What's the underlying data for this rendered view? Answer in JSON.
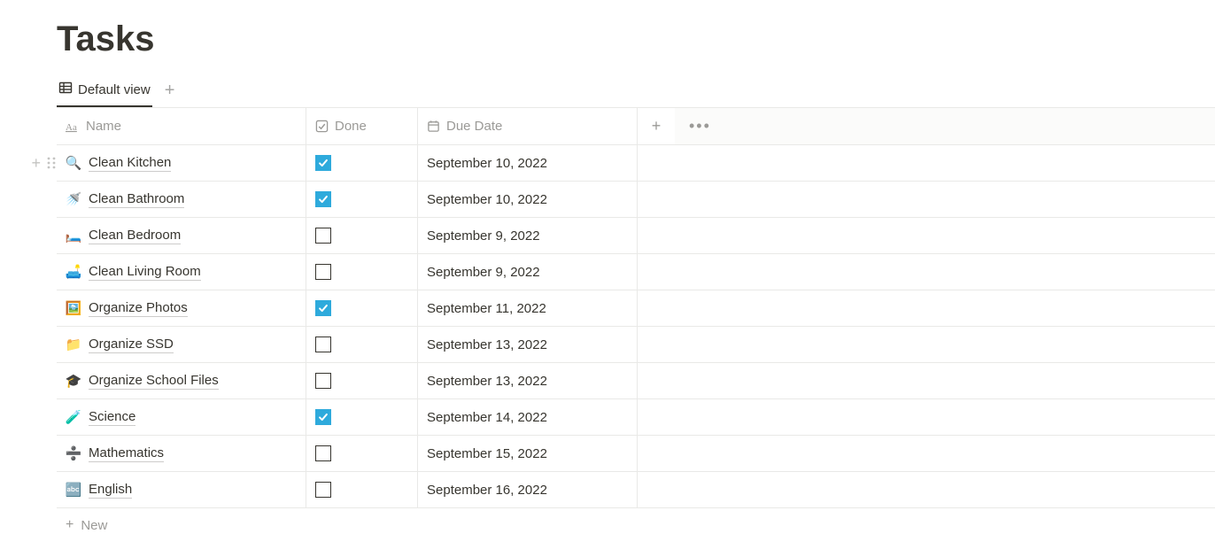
{
  "title": "Tasks",
  "view_tab": "Default view",
  "columns": {
    "name": "Name",
    "done": "Done",
    "due": "Due Date"
  },
  "new_row_label": "New",
  "rows": [
    {
      "emoji": "🔍",
      "name": "Clean Kitchen",
      "done": true,
      "due": "September 10, 2022"
    },
    {
      "emoji": "🚿",
      "name": "Clean Bathroom",
      "done": true,
      "due": "September 10, 2022"
    },
    {
      "emoji": "🛏️",
      "name": "Clean Bedroom",
      "done": false,
      "due": "September 9, 2022"
    },
    {
      "emoji": "🛋️",
      "name": "Clean Living Room",
      "done": false,
      "due": "September 9, 2022"
    },
    {
      "emoji": "🖼️",
      "name": "Organize Photos",
      "done": true,
      "due": "September 11, 2022"
    },
    {
      "emoji": "📁",
      "name": "Organize SSD",
      "done": false,
      "due": "September 13, 2022"
    },
    {
      "emoji": "🎓",
      "name": "Organize School Files",
      "done": false,
      "due": "September 13, 2022"
    },
    {
      "emoji": "🧪",
      "name": "Science",
      "done": true,
      "due": "September 14, 2022"
    },
    {
      "emoji": "➗",
      "name": "Mathematics",
      "done": false,
      "due": "September 15, 2022"
    },
    {
      "emoji": "🔤",
      "name": "English",
      "done": false,
      "due": "September 16, 2022"
    }
  ]
}
